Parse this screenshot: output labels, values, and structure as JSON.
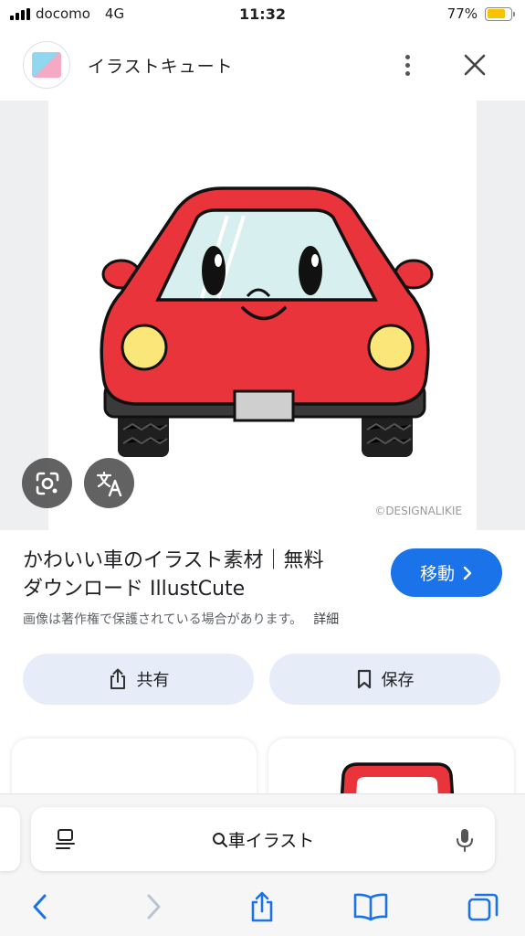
{
  "status_bar": {
    "carrier": "docomo",
    "network": "4G",
    "time": "11:32",
    "battery": "77%",
    "battery_level": 0.77
  },
  "header": {
    "site_name": "イラストキュート",
    "more_icon": "more-vert-icon",
    "close_icon": "close-icon"
  },
  "image": {
    "copyright": "©DESIGNALIKIE",
    "lens_icon": "google-lens-icon",
    "translate_icon": "translate-icon"
  },
  "result": {
    "title_line1": "かわいい車のイラスト素材｜無料",
    "title_line2": "ダウンロード IllustCute",
    "go_label": "移動",
    "copyright_note": "画像は著作権で保護されている場合があります。",
    "details_label": "詳細"
  },
  "actions": {
    "share_label": "共有",
    "save_label": "保存"
  },
  "browser": {
    "query": "車イラスト",
    "reader_icon": "reader-icon",
    "mic_icon": "mic-icon",
    "toolbar": [
      "back-icon",
      "forward-icon",
      "share-icon",
      "bookmarks-icon",
      "tabs-icon"
    ]
  },
  "colors": {
    "accent": "#1a73e8",
    "button_bg": "#e6edf9",
    "car_red": "#e8343a"
  }
}
